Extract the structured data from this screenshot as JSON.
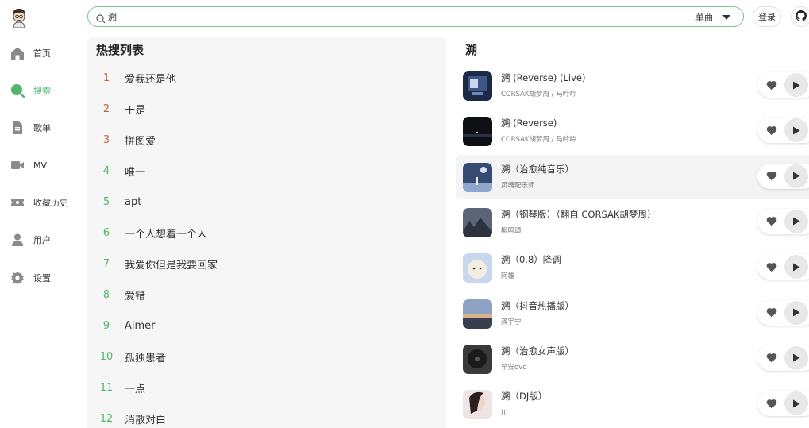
{
  "sidebar": {
    "items": [
      {
        "label": "首页",
        "icon": "home-icon"
      },
      {
        "label": "搜索",
        "icon": "search-circle-icon",
        "active": true
      },
      {
        "label": "歌单",
        "icon": "playlist-doc-icon"
      },
      {
        "label": "MV",
        "icon": "video-camera-icon"
      },
      {
        "label": "收藏历史",
        "icon": "ticket-icon"
      },
      {
        "label": "用户",
        "icon": "user-icon"
      },
      {
        "label": "设置",
        "icon": "gear-icon"
      }
    ],
    "active_color": "#52b56e"
  },
  "search": {
    "value": "溯",
    "type_label": "单曲"
  },
  "header": {
    "login_label": "登录"
  },
  "hot": {
    "title": "热搜列表",
    "items": [
      {
        "rank": "1",
        "word": "爱我还是他"
      },
      {
        "rank": "2",
        "word": "于是"
      },
      {
        "rank": "3",
        "word": "拼图爱"
      },
      {
        "rank": "4",
        "word": "唯一"
      },
      {
        "rank": "5",
        "word": "apt"
      },
      {
        "rank": "6",
        "word": "一个人想着一个人"
      },
      {
        "rank": "7",
        "word": "我爱你但是我要回家"
      },
      {
        "rank": "8",
        "word": "爱错"
      },
      {
        "rank": "9",
        "word": "Aimer"
      },
      {
        "rank": "10",
        "word": "孤独患者"
      },
      {
        "rank": "11",
        "word": "一点"
      },
      {
        "rank": "12",
        "word": "消散对白"
      }
    ],
    "top_rank_color": "#c0653e",
    "rank_color": "#52b56e"
  },
  "results": {
    "title": "溯",
    "songs": [
      {
        "name": "溯 (Reverse) (Live)",
        "artist": "CORSAK胡梦周 / 马吟吟"
      },
      {
        "name": "溯 (Reverse)",
        "artist": "CORSAK胡梦周 / 马吟吟"
      },
      {
        "name": "溯（治愈纯音乐）",
        "artist": "灵魂配乐师"
      },
      {
        "name": "溯（钢琴版）（翻自 CORSAK胡梦周）",
        "artist": "柳鸣颂"
      },
      {
        "name": "溯（0.8）降调",
        "artist": "阿雄"
      },
      {
        "name": "溯（抖音热播版）",
        "artist": "龚宇宁"
      },
      {
        "name": "溯（治愈女声版）",
        "artist": "早安ovo"
      },
      {
        "name": "溯（DJ版）",
        "artist": "川"
      }
    ]
  }
}
